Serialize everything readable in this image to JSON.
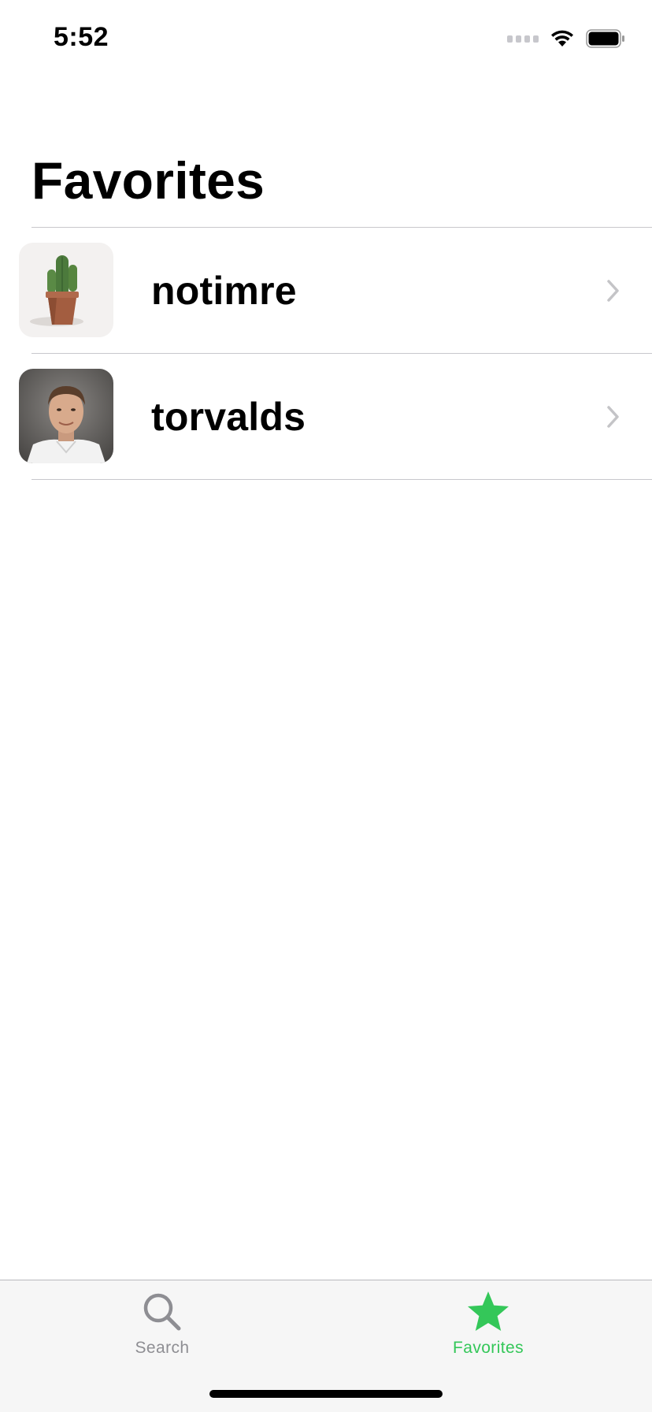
{
  "status_bar": {
    "time": "5:52"
  },
  "navigation": {
    "title": "Favorites"
  },
  "favorites": [
    {
      "username": "notimre",
      "avatar": "cactus-photo"
    },
    {
      "username": "torvalds",
      "avatar": "portrait-photo"
    }
  ],
  "tab_bar": {
    "tabs": [
      {
        "label": "Search",
        "icon": "search-icon",
        "selected": false
      },
      {
        "label": "Favorites",
        "icon": "star-icon",
        "selected": true
      }
    ]
  },
  "colors": {
    "accent": "#34c759",
    "inactive_tab": "#8e8e93",
    "separator": "#c8c7cc",
    "chevron": "#c4c4c7"
  }
}
